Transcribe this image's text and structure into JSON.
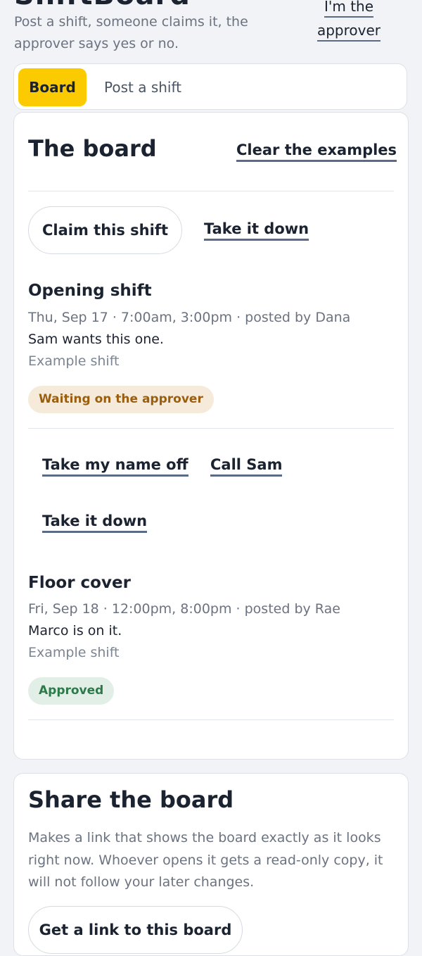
{
  "header": {
    "app_title": "ShiftBoard",
    "tagline": "Post a shift, someone claims it, the approver says yes or no.",
    "approver_link": "I'm the approver"
  },
  "tabs": [
    {
      "label": "Board",
      "active": true
    },
    {
      "label": "Post a shift",
      "active": false
    }
  ],
  "board": {
    "title": "The board",
    "clear_examples": "Clear the examples",
    "top_actions": {
      "claim": "Claim this shift",
      "take_down": "Take it down"
    },
    "shifts": [
      {
        "title": "Opening shift",
        "meta": "Thu, Sep 17 · 7:00am, 3:00pm · posted by Dana",
        "note": "Sam wants this one.",
        "example": "Example shift",
        "status": "Waiting on the approver",
        "actions": [
          "Take my name off",
          "Call Sam",
          "Take it down"
        ]
      },
      {
        "title": "Floor cover",
        "meta": "Fri, Sep 18 · 12:00pm, 8:00pm · posted by Rae",
        "note": "Marco is on it.",
        "example": "Example shift",
        "status": "Approved"
      }
    ]
  },
  "share": {
    "title": "Share the board",
    "description": "Makes a link that shows the board exactly as it looks right now. Whoever opens it gets a read-only copy, it will not follow your later changes.",
    "button": "Get a link to this board"
  },
  "colors": {
    "accent": "#fcca00",
    "waiting_bg": "#f6eadb",
    "waiting_text": "#9a5e0f",
    "approved_bg": "#e2efe6",
    "approved_text": "#2c7a4a"
  }
}
